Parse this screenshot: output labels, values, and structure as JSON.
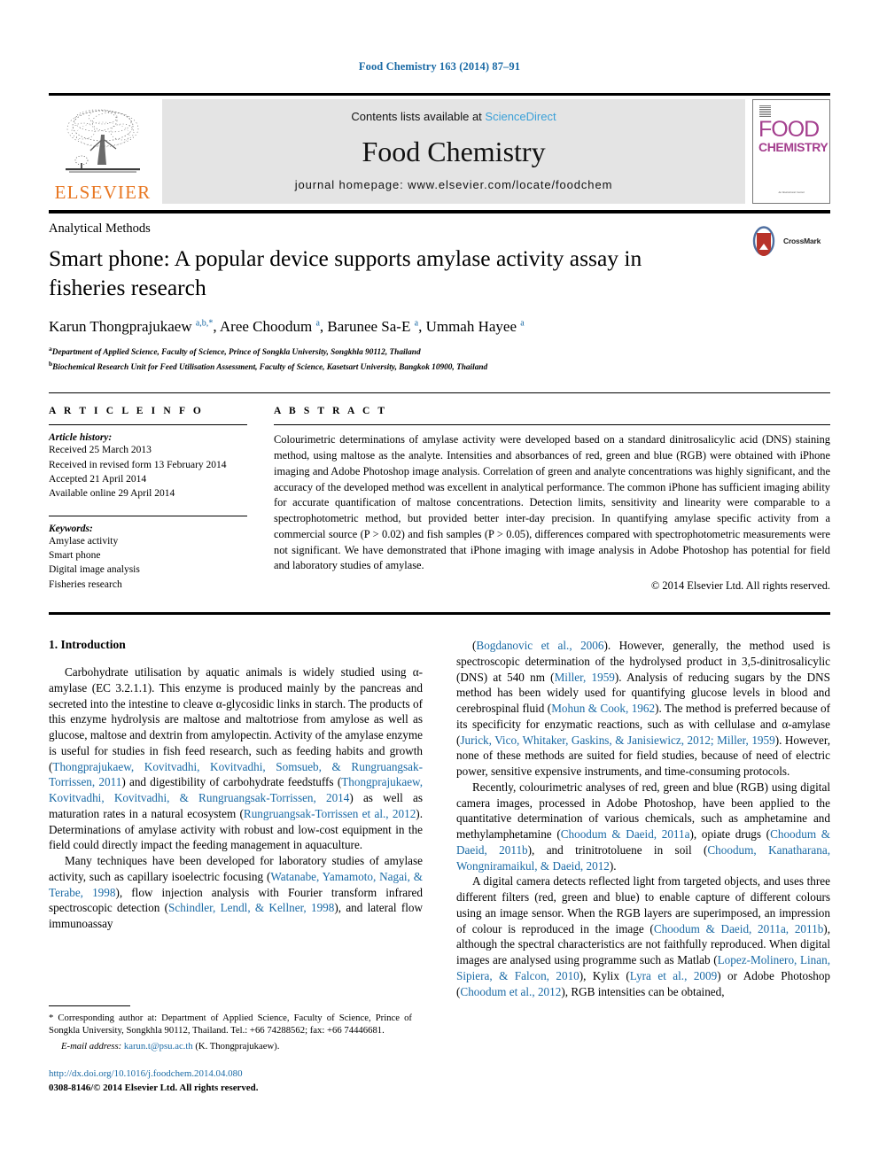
{
  "running_head": "Food Chemistry 163 (2014) 87–91",
  "masthead": {
    "publisher": "ELSEVIER",
    "contents_prefix": "Contents lists available at ",
    "contents_link": "ScienceDirect",
    "journal_name": "Food Chemistry",
    "homepage": "journal homepage: www.elsevier.com/locate/foodchem",
    "cover": {
      "line1": "FOOD",
      "line2": "CHEMISTRY",
      "footer": "An International Journal"
    }
  },
  "article": {
    "subject_section": "Analytical Methods",
    "title": "Smart phone: A popular device supports amylase activity assay in fisheries research",
    "authors_html": "Karun Thongprajukaew <sup>a,b,</sup><sup class=\"star\">*</sup>, Aree Choodum <sup>a</sup>, Barunee Sa-E <sup>a</sup>, Ummah Hayee <sup>a</sup>",
    "affiliation_a": "Department of Applied Science, Faculty of Science, Prince of Songkla University, Songkhla 90112, Thailand",
    "affiliation_b": "Biochemical Research Unit for Feed Utilisation Assessment, Faculty of Science, Kasetsart University, Bangkok 10900, Thailand",
    "crossmark_label": "CrossMark"
  },
  "info": {
    "heading": "A R T I C L E   I N F O",
    "history_label": "Article history:",
    "history": [
      "Received 25 March 2013",
      "Received in revised form 13 February 2014",
      "Accepted 21 April 2014",
      "Available online 29 April 2014"
    ],
    "keywords_label": "Keywords:",
    "keywords": [
      "Amylase activity",
      "Smart phone",
      "Digital image analysis",
      "Fisheries research"
    ]
  },
  "abstract": {
    "heading": "A B S T R A C T",
    "text": "Colourimetric determinations of amylase activity were developed based on a standard dinitrosalicylic acid (DNS) staining method, using maltose as the analyte. Intensities and absorbances of red, green and blue (RGB) were obtained with iPhone imaging and Adobe Photoshop image analysis. Correlation of green and analyte concentrations was highly significant, and the accuracy of the developed method was excellent in analytical performance. The common iPhone has sufficient imaging ability for accurate quantification of maltose concentrations. Detection limits, sensitivity and linearity were comparable to a spectrophotometric method, but provided better inter-day precision. In quantifying amylase specific activity from a commercial source (P > 0.02) and fish samples (P > 0.05), differences compared with spectrophotometric measurements were not significant. We have demonstrated that iPhone imaging with image analysis in Adobe Photoshop has potential for field and laboratory studies of amylase.",
    "copyright": "© 2014 Elsevier Ltd. All rights reserved."
  },
  "body": {
    "section_title": "1. Introduction",
    "left_p1_html": "Carbohydrate utilisation by aquatic animals is widely studied using &alpha;-amylase (EC 3.2.1.1). This enzyme is produced mainly by the pancreas and secreted into the intestine to cleave &alpha;-glycosidic links in starch. The products of this enzyme hydrolysis are maltose and maltotriose from amylose as well as glucose, maltose and dextrin from amylopectin. Activity of the amylase enzyme is useful for studies in fish feed research, such as feeding habits and growth (<span class=\"ref\">Thongprajukaew, Kovitvadhi, Kovitvadhi, Somsueb, &amp; Rungruangsak-Torrissen, 2011</span>) and digestibility of carbohydrate feedstuffs (<span class=\"ref\">Thongprajukaew, Kovitvadhi, Kovitvadhi, &amp; Rungruangsak-Torrissen, 2014</span>) as well as maturation rates in a natural ecosystem (<span class=\"ref\">Rungruangsak-Torrissen et al., 2012</span>). Determinations of amylase activity with robust and low-cost equipment in the field could directly impact the feeding management in aquaculture.",
    "left_p2_html": "Many techniques have been developed for laboratory studies of amylase activity, such as capillary isoelectric focusing (<span class=\"ref\">Watanabe, Yamamoto, Nagai, &amp; Terabe, 1998</span>), flow injection analysis with Fourier transform infrared spectroscopic detection (<span class=\"ref\">Schindler, Lendl, &amp; Kellner, 1998</span>), and lateral flow immunoassay",
    "right_p1_html": "(<span class=\"ref\">Bogdanovic et al., 2006</span>). However, generally, the method used is spectroscopic determination of the hydrolysed product in 3,5-dinitrosalicylic (DNS) at 540 nm (<span class=\"ref\">Miller, 1959</span>). Analysis of reducing sugars by the DNS method has been widely used for quantifying glucose levels in blood and cerebrospinal fluid (<span class=\"ref\">Mohun &amp; Cook, 1962</span>). The method is preferred because of its specificity for enzymatic reactions, such as with cellulase and &alpha;-amylase (<span class=\"ref\">Jurick, Vico, Whitaker, Gaskins, &amp; Janisiewicz, 2012; Miller, 1959</span>). However, none of these methods are suited for field studies, because of need of electric power, sensitive expensive instruments, and time-consuming protocols.",
    "right_p2_html": "Recently, colourimetric analyses of red, green and blue (RGB) using digital camera images, processed in Adobe Photoshop, have been applied to the quantitative determination of various chemicals, such as amphetamine and methylamphetamine (<span class=\"ref\">Choodum &amp; Daeid, 2011a</span>), opiate drugs (<span class=\"ref\">Choodum &amp; Daeid, 2011b</span>), and trinitrotoluene in soil (<span class=\"ref\">Choodum, Kanatharana, Wongniramaikul, &amp; Daeid, 2012</span>).",
    "right_p3_html": "A digital camera detects reflected light from targeted objects, and uses three different filters (red, green and blue) to enable capture of different colours using an image sensor. When the RGB layers are superimposed, an impression of colour is reproduced in the image (<span class=\"ref\">Choodum &amp; Daeid, 2011a, 2011b</span>), although the spectral characteristics are not faithfully reproduced. When digital images are analysed using programme such as Matlab (<span class=\"ref\">Lopez-Molinero, Linan, Sipiera, &amp; Falcon, 2010</span>), Kylix (<span class=\"ref\">Lyra et al., 2009</span>) or Adobe Photoshop (<span class=\"ref\">Choodum et al., 2012</span>), RGB intensities can be obtained,"
  },
  "footnotes": {
    "corresponding_html": "* Corresponding author at: Department of Applied Science, Faculty of Science, Prince of Songkla University, Songkhla 90112, Thailand. Tel.: +66 74288562; fax: +66 74446681.",
    "email_label": "E-mail address:",
    "email": "karun.t@psu.ac.th",
    "email_suffix": "(K. Thongprajukaew).",
    "doi": "http://dx.doi.org/10.1016/j.foodchem.2014.04.080",
    "issn_line": "0308-8146/© 2014 Elsevier Ltd. All rights reserved."
  },
  "colors": {
    "link_blue": "#1a6aa5",
    "sciencedirect_blue": "#3aa0d8",
    "elsevier_orange": "#E87722",
    "cover_magenta": "#a43f8e",
    "crossmark_red": "#b8332a",
    "crossmark_blue": "#4f6fa0"
  }
}
